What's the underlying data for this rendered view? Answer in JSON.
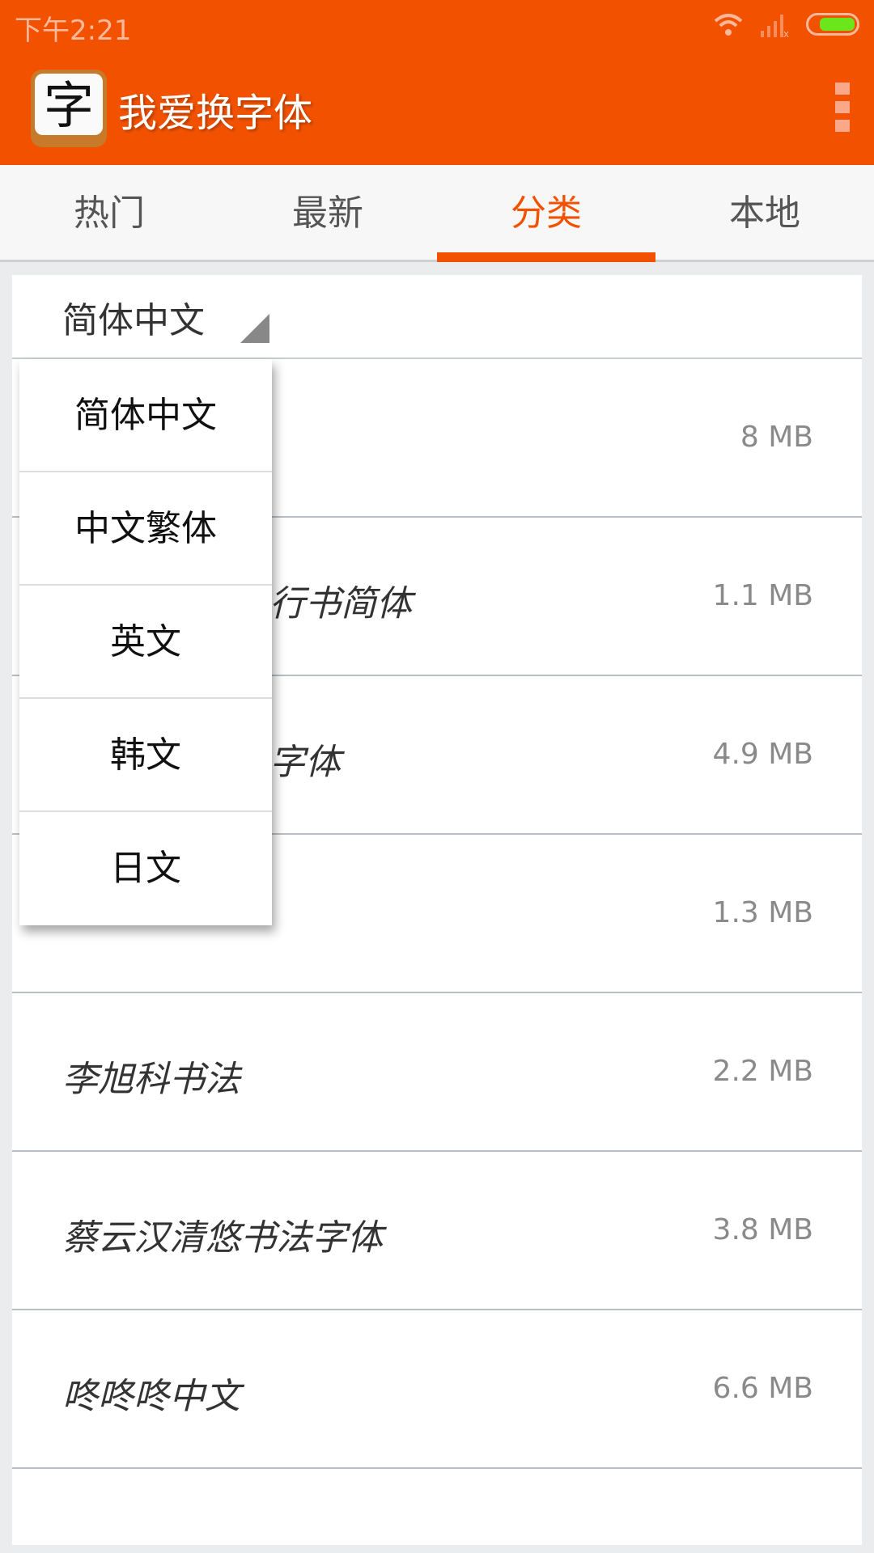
{
  "status": {
    "time": "下午2:21",
    "battery_color": "#6be61a"
  },
  "app": {
    "title": "我爱换字体",
    "logo_char": "字",
    "brand_color": "#f25200"
  },
  "tabs": [
    {
      "label": "热门"
    },
    {
      "label": "最新"
    },
    {
      "label": "分类",
      "active": true
    },
    {
      "label": "本地"
    }
  ],
  "spinner": {
    "selected": "简体中文"
  },
  "dropdown": {
    "options": [
      "简体中文",
      "中文繁体",
      "英文",
      "韩文",
      "日文"
    ]
  },
  "fonts": [
    {
      "name": "",
      "size": "8 MB"
    },
    {
      "name": "行书简体",
      "size": "1.1 MB"
    },
    {
      "name": "字体",
      "size": "4.9 MB"
    },
    {
      "name": "",
      "size": "1.3 MB"
    },
    {
      "name": "李旭科书法",
      "size": "2.2 MB"
    },
    {
      "name": "蔡云汉清悠书法字体",
      "size": "3.8 MB"
    },
    {
      "name": "咚咚咚中文",
      "size": "6.6 MB"
    },
    {
      "name": "",
      "size": ""
    }
  ]
}
